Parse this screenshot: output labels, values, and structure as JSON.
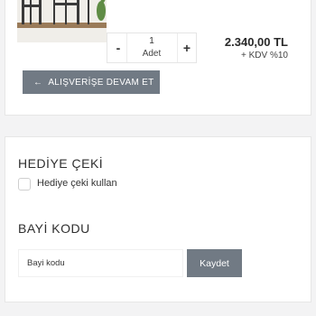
{
  "cart_item": {
    "thumbnail_icon": "furniture-product-photo",
    "quantity": {
      "minus_label": "-",
      "plus_label": "+",
      "value": "1",
      "unit": "Adet"
    },
    "price": "2.340,00 TL",
    "vat": "+ KDV %10"
  },
  "continue_shopping": {
    "icon": "arrow-left-icon",
    "arrow": "←",
    "label": "ALIŞVERİŞE DEVAM ET"
  },
  "gift_card": {
    "title": "HEDİYE ÇEKİ",
    "checkbox_label": "Hediye çeki kullan"
  },
  "dealer_code": {
    "title": "BAYİ KODU",
    "input_placeholder": "Bayi kodu",
    "save_label": "Kaydet"
  },
  "colors": {
    "page_bg": "#f3f3f4",
    "button_bg": "#717a84",
    "text": "#333333"
  }
}
